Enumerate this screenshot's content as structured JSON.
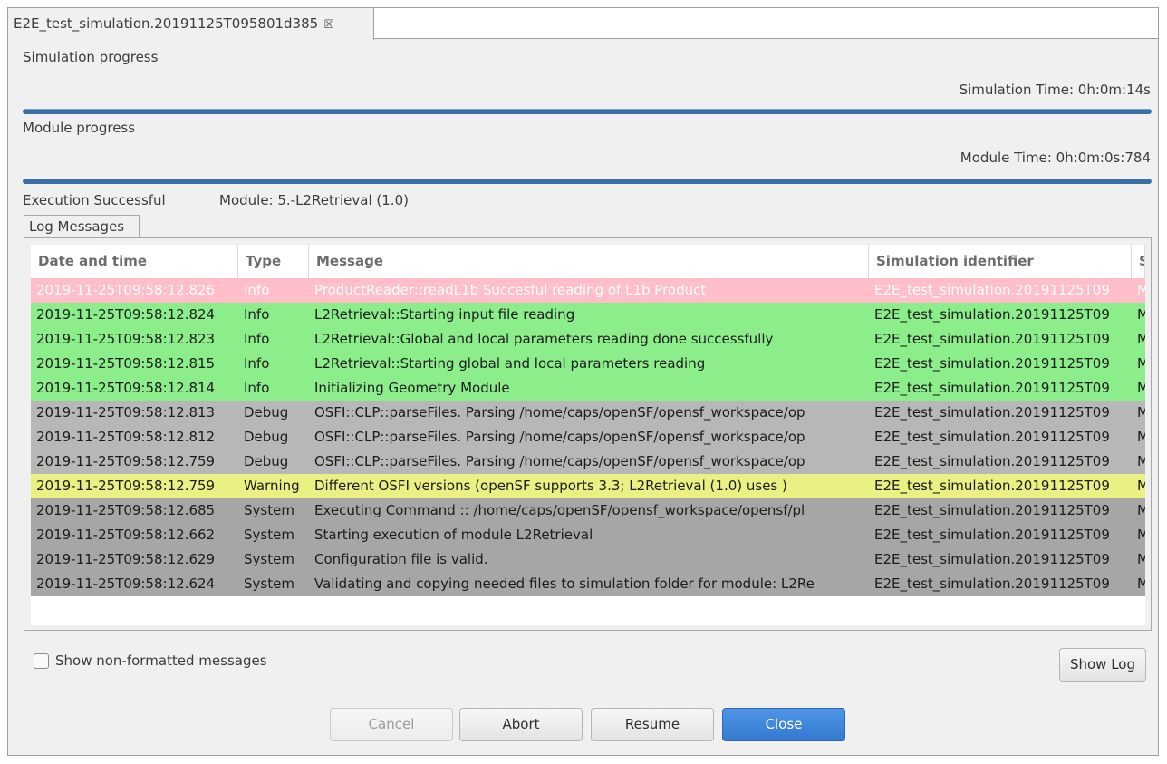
{
  "tab": {
    "title": "E2E_test_simulation.20191125T095801d385",
    "close_glyph": "☒"
  },
  "simulation": {
    "label": "Simulation progress",
    "time": "Simulation Time: 0h:0m:14s",
    "progress": 1.0
  },
  "module": {
    "label": "Module progress",
    "time": "Module Time: 0h:0m:0s:784",
    "progress": 1.0
  },
  "status": {
    "text": "Execution Successful",
    "module": "Module: 5.-L2Retrieval (1.0)"
  },
  "log": {
    "tab_label": "Log Messages",
    "columns": {
      "date": "Date and time",
      "type": "Type",
      "message": "Message",
      "sim": "Simulation identifier",
      "s": "S"
    },
    "rows": [
      {
        "date": "2019-11-25T09:58:12.826",
        "type": "Info",
        "message": "ProductReader::readL1b Succesful reading of L1b Product",
        "sim": "E2E_test_simulation.20191125T09",
        "s": "M",
        "bg": "#ffbec8",
        "fg": "#ffffff"
      },
      {
        "date": "2019-11-25T09:58:12.824",
        "type": "Info",
        "message": "L2Retrieval::Starting input file reading",
        "sim": "E2E_test_simulation.20191125T09",
        "s": "M",
        "bg": "#8ced8b",
        "fg": "#1c1c1c"
      },
      {
        "date": "2019-11-25T09:58:12.823",
        "type": "Info",
        "message": "L2Retrieval::Global and local parameters reading done successfully",
        "sim": "E2E_test_simulation.20191125T09",
        "s": "M",
        "bg": "#8ced8b",
        "fg": "#1c1c1c"
      },
      {
        "date": "2019-11-25T09:58:12.815",
        "type": "Info",
        "message": "L2Retrieval::Starting global and local parameters reading",
        "sim": "E2E_test_simulation.20191125T09",
        "s": "M",
        "bg": "#8ced8b",
        "fg": "#1c1c1c"
      },
      {
        "date": "2019-11-25T09:58:12.814",
        "type": "Info",
        "message": "Initializing Geometry Module",
        "sim": "E2E_test_simulation.20191125T09",
        "s": "M",
        "bg": "#8ced8b",
        "fg": "#1c1c1c"
      },
      {
        "date": "2019-11-25T09:58:12.813",
        "type": "Debug",
        "message": "OSFI::CLP::parseFiles. Parsing /home/caps/openSF/opensf_workspace/op",
        "sim": "E2E_test_simulation.20191125T09",
        "s": "M",
        "bg": "#b7b7b7",
        "fg": "#1c1c1c"
      },
      {
        "date": "2019-11-25T09:58:12.812",
        "type": "Debug",
        "message": "OSFI::CLP::parseFiles. Parsing /home/caps/openSF/opensf_workspace/op",
        "sim": "E2E_test_simulation.20191125T09",
        "s": "M",
        "bg": "#b7b7b7",
        "fg": "#1c1c1c"
      },
      {
        "date": "2019-11-25T09:58:12.759",
        "type": "Debug",
        "message": "OSFI::CLP::parseFiles. Parsing /home/caps/openSF/opensf_workspace/op",
        "sim": "E2E_test_simulation.20191125T09",
        "s": "M",
        "bg": "#b7b7b7",
        "fg": "#1c1c1c"
      },
      {
        "date": "2019-11-25T09:58:12.759",
        "type": "Warning",
        "message": "Different OSFI versions (openSF supports 3.3; L2Retrieval (1.0) uses )",
        "sim": "E2E_test_simulation.20191125T09",
        "s": "M",
        "bg": "#eaf084",
        "fg": "#1c1c1c"
      },
      {
        "date": "2019-11-25T09:58:12.685",
        "type": "System",
        "message": "Executing Command :: /home/caps/openSF/opensf_workspace/opensf/pl",
        "sim": "E2E_test_simulation.20191125T09",
        "s": "M",
        "bg": "#a6a6a6",
        "fg": "#1c1c1c"
      },
      {
        "date": "2019-11-25T09:58:12.662",
        "type": "System",
        "message": "Starting execution of module L2Retrieval",
        "sim": "E2E_test_simulation.20191125T09",
        "s": "M",
        "bg": "#a6a6a6",
        "fg": "#1c1c1c"
      },
      {
        "date": "2019-11-25T09:58:12.629",
        "type": "System",
        "message": "Configuration file is valid.",
        "sim": "E2E_test_simulation.20191125T09",
        "s": "M",
        "bg": "#a6a6a6",
        "fg": "#1c1c1c"
      },
      {
        "date": "2019-11-25T09:58:12.624",
        "type": "System",
        "message": "Validating and copying needed files to simulation folder for module: L2Re",
        "sim": "E2E_test_simulation.20191125T09",
        "s": "M",
        "bg": "#a6a6a6",
        "fg": "#1c1c1c"
      }
    ]
  },
  "options": {
    "show_nonformatted_label": "Show non-formatted messages",
    "show_nonformatted_checked": false,
    "show_log_label": "Show Log"
  },
  "buttons": {
    "cancel": "Cancel",
    "abort": "Abort",
    "resume": "Resume",
    "close": "Close"
  },
  "colors": {
    "progress": "#3a6ea5",
    "primary_button": "#3b84da",
    "window_bg": "#f0f0f0"
  }
}
